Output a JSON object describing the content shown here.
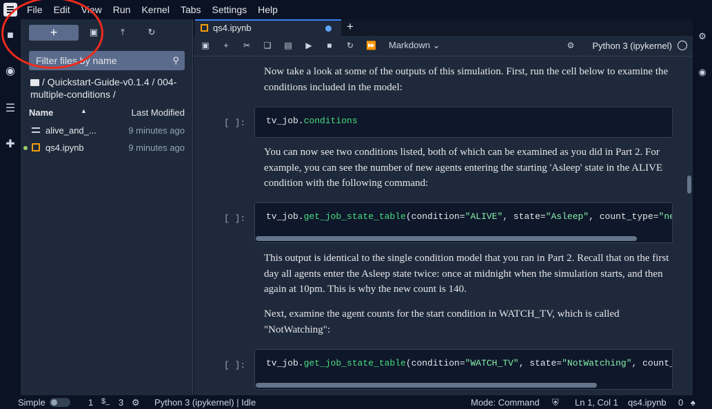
{
  "menu": [
    "File",
    "Edit",
    "View",
    "Run",
    "Kernel",
    "Tabs",
    "Settings",
    "Help"
  ],
  "file_browser": {
    "new_label": "+",
    "filter_placeholder": "Filter files by name",
    "breadcrumb": "/ Quickstart-Guide-v0.1.4 / 004-multiple-conditions /",
    "col_name": "Name",
    "col_modified": "Last Modified",
    "files": [
      {
        "name": "alive_and_...",
        "modified": "9 minutes ago",
        "icon": "text-file-icon",
        "running": false
      },
      {
        "name": "qs4.ipynb",
        "modified": "9 minutes ago",
        "icon": "notebook-icon",
        "running": true
      }
    ]
  },
  "tab": {
    "label": "qs4.ipynb",
    "add": "+"
  },
  "toolbar": {
    "cell_type": "Markdown",
    "kernel": "Python 3 (ipykernel)"
  },
  "cells": {
    "md1": "Now take a look at some of the outputs of this simulation. First, run the cell below to examine the conditions included in the model:",
    "prompt1": "[ ]:",
    "code1_a": "tv_job.",
    "code1_b": "conditions",
    "md2": "You can now see two conditions listed, both of which can be examined as you did in Part 2. For example, you can see the number of new agents entering the starting 'Asleep' state in the ALIVE condition with the following command:",
    "prompt2": "[ ]:",
    "code2": {
      "a": "tv_job.",
      "fn": "get_job_state_table",
      "b": "(condition=",
      "s1": "\"ALIVE\"",
      "c": ", state=",
      "s2": "\"Asleep\"",
      "d": ", count_type=",
      "s3": "\"new\")"
    },
    "md3": "This output is identical to the single condition model that you ran in Part 2. Recall that on the first day all agents enter the Asleep state twice: once at midnight when the simulation starts, and then again at 10pm. This is why the new count is 140.",
    "md4": "Next, examine the agent counts for the start condition in WATCH_TV, which is called \"NotWatching\":",
    "prompt3": "[ ]:",
    "code3": {
      "a": "tv_job.",
      "fn": "get_job_state_table",
      "b": "(condition=",
      "s1": "\"WATCH_TV\"",
      "c": ", state=",
      "s2": "\"NotWatching\"",
      "d": ", count_type=\"new\")"
    }
  },
  "statusbar": {
    "mode_label": "Simple",
    "terminals": "1",
    "kernels": "3",
    "kernel_status": "Python 3 (ipykernel) | Idle",
    "mode": "Mode: Command",
    "position": "Ln 1, Col 1",
    "filename": "qs4.ipynb",
    "notifications": "0"
  },
  "colors": {
    "accent": "#3b82f6",
    "annotation": "#ef2b1d",
    "notebook_icon": "#f59e0b"
  }
}
